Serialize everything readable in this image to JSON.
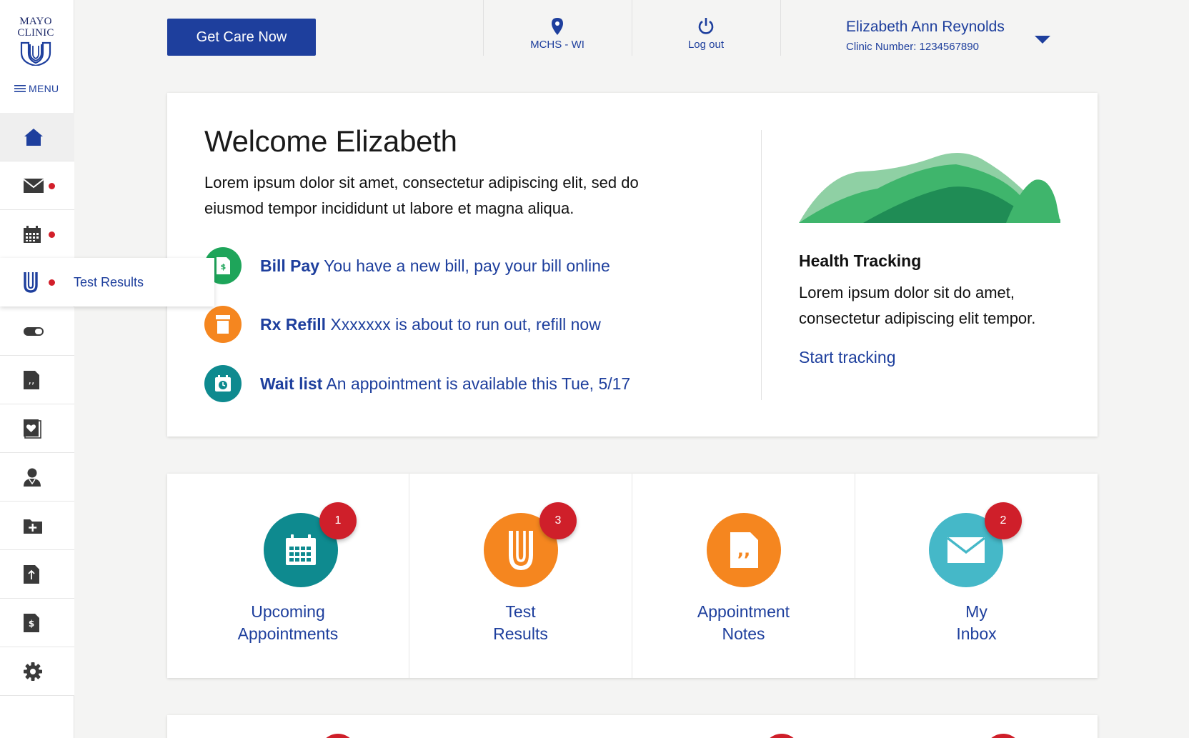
{
  "brand": {
    "logo_line1": "MAYO",
    "logo_line2": "CLINIC",
    "primary_color": "#1e3f9d",
    "alert_color": "#d21f2a"
  },
  "sidebar": {
    "menu_label": "MENU",
    "items": [
      {
        "icon": "home-icon",
        "active": true,
        "dot": false
      },
      {
        "icon": "mail-icon",
        "active": false,
        "dot": true
      },
      {
        "icon": "calendar-icon",
        "active": false,
        "dot": true
      },
      {
        "icon": "test-tube-icon",
        "active": false,
        "dot": true,
        "label": "Test Results"
      },
      {
        "icon": "pill-icon",
        "active": false,
        "dot": false
      },
      {
        "icon": "notes-icon",
        "active": false,
        "dot": false
      },
      {
        "icon": "health-record-icon",
        "active": false,
        "dot": false
      },
      {
        "icon": "doctor-icon",
        "active": false,
        "dot": false
      },
      {
        "icon": "folder-add-icon",
        "active": false,
        "dot": false
      },
      {
        "icon": "upload-document-icon",
        "active": false,
        "dot": false
      },
      {
        "icon": "billing-icon",
        "active": false,
        "dot": false
      },
      {
        "icon": "gear-icon",
        "active": false,
        "dot": false
      }
    ]
  },
  "header": {
    "get_care_label": "Get Care Now",
    "location_label": "MCHS - WI",
    "logout_label": "Log out",
    "user_name": "Elizabeth Ann Reynolds",
    "clinic_number": "Clinic Number: 1234567890"
  },
  "welcome": {
    "title": "Welcome Elizabeth",
    "body": "Lorem ipsum dolor sit amet, consectetur adipiscing elit, sed do eiusmod tempor incididunt ut labore et magna aliqua.",
    "alerts": [
      {
        "title": "Bill Pay",
        "text": "You have a new bill, pay your bill online",
        "icon": "bill-icon",
        "color": "#1ea55a"
      },
      {
        "title": "Rx Refill",
        "text": "Xxxxxxx is about to run out, refill now",
        "icon": "rx-bottle-icon",
        "color": "#f5861f"
      },
      {
        "title": "Wait list",
        "text": "An appointment is available this Tue, 5/17",
        "icon": "calendar-clock-icon",
        "color": "#0e8a8f"
      }
    ],
    "health_tracking": {
      "title": "Health Tracking",
      "body": "Lorem ipsum dolor sit do amet, consectetur adipiscing elit tempor.",
      "link": "Start tracking"
    }
  },
  "tiles": [
    {
      "label": "Upcoming\nAppointments",
      "badge": "1",
      "icon": "calendar-icon",
      "color": "#0e8a8f"
    },
    {
      "label": "Test\nResults",
      "badge": "3",
      "icon": "test-tube-icon",
      "color": "#f5861f"
    },
    {
      "label": "Appointment\nNotes",
      "badge": "",
      "icon": "notes-icon",
      "color": "#f5861f"
    },
    {
      "label": "My\nInbox",
      "badge": "2",
      "icon": "mail-icon",
      "color": "#45b8c8"
    }
  ]
}
